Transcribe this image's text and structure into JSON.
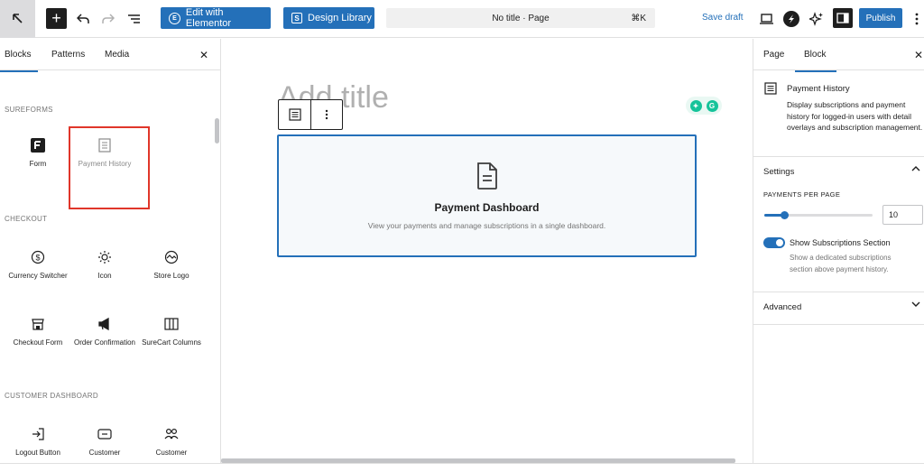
{
  "topbar": {
    "elementor_label": "Edit with Elementor",
    "design_library_label": "Design Library",
    "doc_title": "No title · Page",
    "doc_shortcut": "⌘K",
    "save_draft": "Save draft",
    "publish": "Publish"
  },
  "inserter": {
    "tabs": [
      "Blocks",
      "Patterns",
      "Media"
    ],
    "categories": {
      "sureforms": "SUREFORMS",
      "checkout": "CHECKOUT",
      "customer_dashboard": "CUSTOMER DASHBOARD"
    },
    "sureforms_blocks": [
      "Form",
      "Payment History"
    ],
    "checkout_blocks": [
      "Currency Switcher",
      "Icon",
      "Store Logo",
      "Checkout Form",
      "Order Confirmation",
      "SureCart Columns"
    ],
    "dashboard_blocks": [
      "Logout Button",
      "Customer",
      "Customer"
    ]
  },
  "canvas": {
    "title_placeholder": "Add title",
    "block_title": "Payment Dashboard",
    "block_subtitle": "View your payments and manage subscriptions in a single dashboard."
  },
  "settings": {
    "tabs": [
      "Page",
      "Block"
    ],
    "block_name": "Payment History",
    "block_description": "Display subscriptions and payment history for logged-in users with detail overlays and subscription management.",
    "panel_settings_title": "Settings",
    "payments_per_page_label": "PAYMENTS PER PAGE",
    "payments_per_page_value": "10",
    "slider_fraction": 0.18,
    "toggle_label": "Show Subscriptions Section",
    "toggle_on": true,
    "toggle_help": "Show a dedicated subscriptions section above payment history.",
    "panel_advanced_title": "Advanced"
  },
  "colors": {
    "accent": "#2470b9",
    "highlight": "#e0362a"
  }
}
